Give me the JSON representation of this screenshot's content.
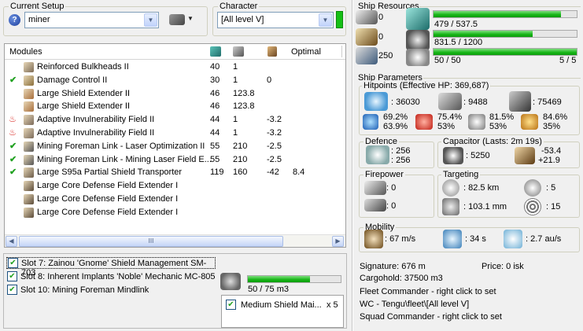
{
  "setup": {
    "title": "Current Setup",
    "value": "miner"
  },
  "character": {
    "title": "Character",
    "value": "[All level V]"
  },
  "modules": {
    "headers": {
      "name": "Modules",
      "optimal": "Optimal"
    },
    "rows": [
      {
        "name": "Reinforced Bulkheads II",
        "c1": "40",
        "c2": "1",
        "c3": "",
        "c4": "",
        "status": ""
      },
      {
        "name": "Damage Control II",
        "c1": "30",
        "c2": "1",
        "c3": "0",
        "c4": "",
        "status": "check"
      },
      {
        "name": "Large Shield Extender II",
        "c1": "46",
        "c2": "123.8",
        "c3": "",
        "c4": "",
        "status": ""
      },
      {
        "name": "Large Shield Extender II",
        "c1": "46",
        "c2": "123.8",
        "c3": "",
        "c4": "",
        "status": ""
      },
      {
        "name": "Adaptive Invulnerability Field II",
        "c1": "44",
        "c2": "1",
        "c3": "-3.2",
        "c4": "",
        "status": "fire"
      },
      {
        "name": "Adaptive Invulnerability Field II",
        "c1": "44",
        "c2": "1",
        "c3": "-3.2",
        "c4": "",
        "status": "fire"
      },
      {
        "name": "Mining Foreman Link - Laser Optimization II",
        "c1": "55",
        "c2": "210",
        "c3": "-2.5",
        "c4": "",
        "status": "check"
      },
      {
        "name": "Mining Foreman Link - Mining Laser Field E...",
        "c1": "55",
        "c2": "210",
        "c3": "-2.5",
        "c4": "",
        "status": "check"
      },
      {
        "name": "Large S95a Partial Shield Transporter",
        "c1": "119",
        "c2": "160",
        "c3": "-42",
        "c4": "8.4",
        "status": "check"
      },
      {
        "name": "Large Core Defense Field Extender I",
        "c1": "",
        "c2": "",
        "c3": "",
        "c4": "",
        "status": ""
      },
      {
        "name": "Large Core Defense Field Extender I",
        "c1": "",
        "c2": "",
        "c3": "",
        "c4": "",
        "status": ""
      },
      {
        "name": "Large Core Defense Field Extender I",
        "c1": "",
        "c2": "",
        "c3": "",
        "c4": "",
        "status": ""
      }
    ],
    "scroll_grip": "III"
  },
  "implants": [
    {
      "label": "Slot 7: Zainou 'Gnome' Shield Management SM-703",
      "checked": true
    },
    {
      "label": "Slot 8: Inherent Implants 'Noble' Mechanic MC-805",
      "checked": true
    },
    {
      "label": "Slot 10: Mining Foreman Mindlink",
      "checked": true
    }
  ],
  "drones": {
    "bandwidth": "50 / 75 m3",
    "bandwidth_fraction": 0.667,
    "item": "Medium Shield Mai...",
    "qty": "x 5"
  },
  "resources": {
    "title": "Ship Resources",
    "hardpoints": [
      "0",
      "0",
      "250"
    ],
    "cpu": {
      "text": "479 / 537.5",
      "fraction": 0.891
    },
    "power": {
      "text": "831.5 / 1200",
      "fraction": 0.693
    },
    "calibration": {
      "text": "50 / 50",
      "fraction": 1.0
    },
    "rig_slots": "5 / 5"
  },
  "params": {
    "title": "Ship Parameters",
    "hp_title": "Hitpoints (Effective HP: 369,687)",
    "shield": "36030",
    "armor": "9488",
    "hull": "75469",
    "res": [
      [
        "69.2%",
        "63.9%"
      ],
      [
        "75.4%",
        "53%"
      ],
      [
        "81.5%",
        "53%"
      ],
      [
        "84.6%",
        "35%"
      ]
    ],
    "defence_title": "Defence",
    "def1": ": 256",
    "def2": ": 256",
    "capacitor_title": "Capacitor (Lasts: 2m 19s)",
    "cap_amount": ": 5250",
    "cap_use": "-53.4",
    "cap_regen": "+21.9",
    "firepower_title": "Firepower",
    "fp1": ": 0",
    "fp2": ": 0",
    "targeting_title": "Targeting",
    "range": ": 82.5 km",
    "targets": ": 5",
    "scan_res": ": 103.1 mm",
    "sensor": ": 15",
    "mobility_title": "Mobility",
    "speed": ": 67 m/s",
    "align": ": 34 s",
    "warp": ": 2.7 au/s"
  },
  "footer": {
    "signature": "Signature: 676 m",
    "price": "Price: 0 isk",
    "cargohold": "Cargohold: 37500 m3",
    "fleet_commander": "Fleet Commander - right click to set",
    "wing_commander": "WC - Tengu\\fleet\\[All level V]",
    "squad_commander": "Squad Commander - right click to set"
  },
  "colors": {
    "bar": "#16b416",
    "link_check": "#21a121",
    "fire": "#d8241e"
  }
}
